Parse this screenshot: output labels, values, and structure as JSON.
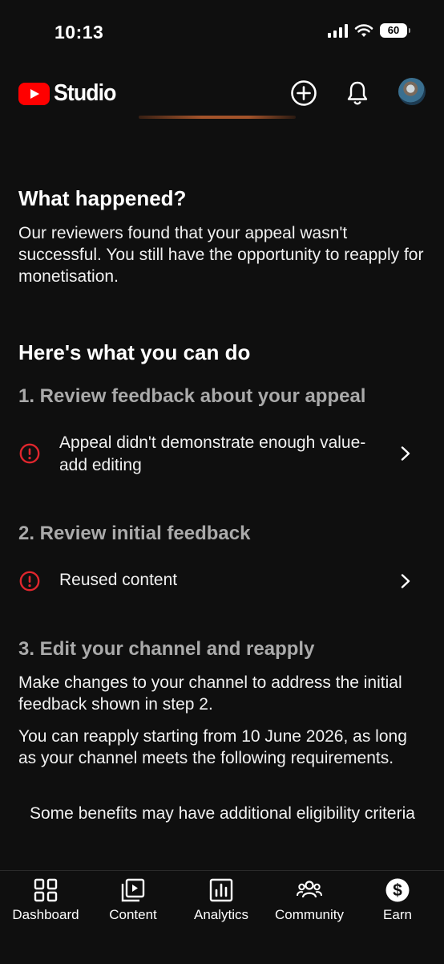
{
  "status_bar": {
    "time": "10:13",
    "battery": "60"
  },
  "header": {
    "logo_text": "Studio",
    "add_icon": "add-circle-icon",
    "notifications_icon": "bell-icon",
    "avatar": "avatar"
  },
  "what_happened": {
    "title": "What happened?",
    "body": "Our reviewers found that your appeal wasn't successful. You still have the opportunity to reapply for monetisation."
  },
  "what_you_can_do": {
    "title": "Here's what you can do",
    "step1": {
      "title": "1. Review feedback about your appeal",
      "item": "Appeal didn't demonstrate enough value-add editing"
    },
    "step2": {
      "title": "2. Review initial feedback",
      "item": "Reused content"
    },
    "step3": {
      "title": "3. Edit your channel and reapply",
      "body1": "Make changes to your channel to address the initial feedback shown in step 2.",
      "body2": "You can reapply starting from 10 June 2026, as long as your channel meets the following requirements.",
      "note": "Some benefits may have additional eligibility criteria"
    }
  },
  "nav": [
    {
      "label": "Dashboard",
      "icon": "dashboard-icon"
    },
    {
      "label": "Content",
      "icon": "content-icon"
    },
    {
      "label": "Analytics",
      "icon": "analytics-icon"
    },
    {
      "label": "Community",
      "icon": "community-icon"
    },
    {
      "label": "Earn",
      "icon": "earn-icon"
    }
  ],
  "colors": {
    "background": "#0f0f0f",
    "accent_red": "#ff0000",
    "alert_red": "#e0262d",
    "muted_heading": "#aaaaaa"
  }
}
